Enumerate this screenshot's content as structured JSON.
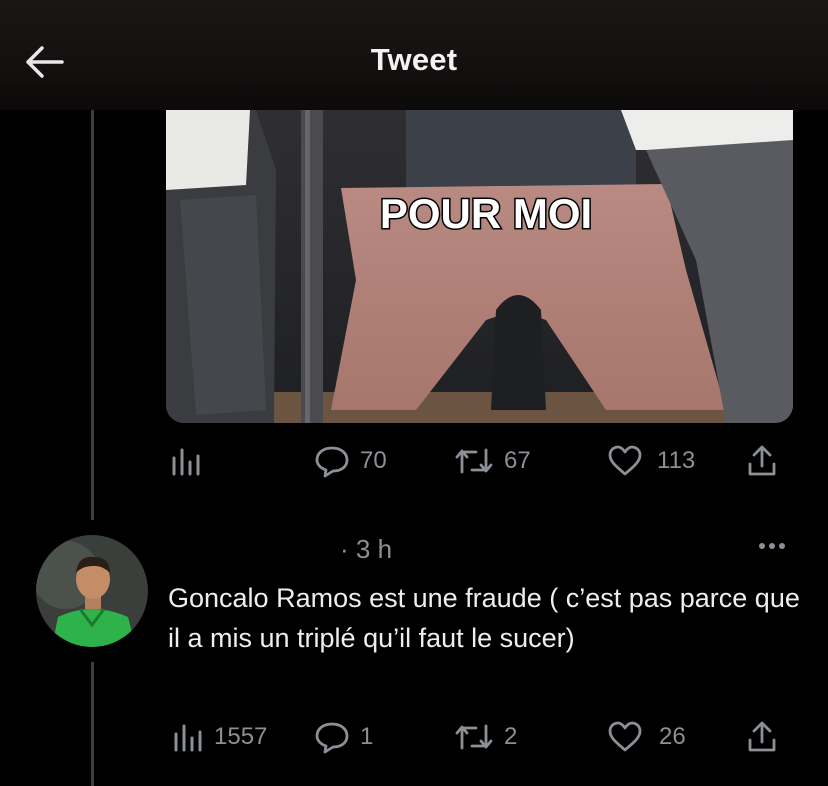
{
  "header": {
    "title": "Tweet",
    "back_icon": "back-arrow-icon"
  },
  "media": {
    "overlay_text": "POUR MOI"
  },
  "tweet_actions": {
    "views_icon": "views-chart-icon",
    "replies": "70",
    "retweets": "67",
    "likes": "113",
    "share_icon": "share-icon"
  },
  "reply": {
    "time": "· 3 h",
    "text": "Goncalo Ramos est une fraude ( c’est pas parce que il a mis un triplé qu’il faut le sucer)",
    "views": "1557",
    "replies": "1",
    "retweets": "2",
    "likes": "26",
    "jersey_color": "#2db34a"
  },
  "colors": {
    "background": "#000000",
    "muted_text": "#8b9096",
    "thread_line": "#3a3d41"
  }
}
